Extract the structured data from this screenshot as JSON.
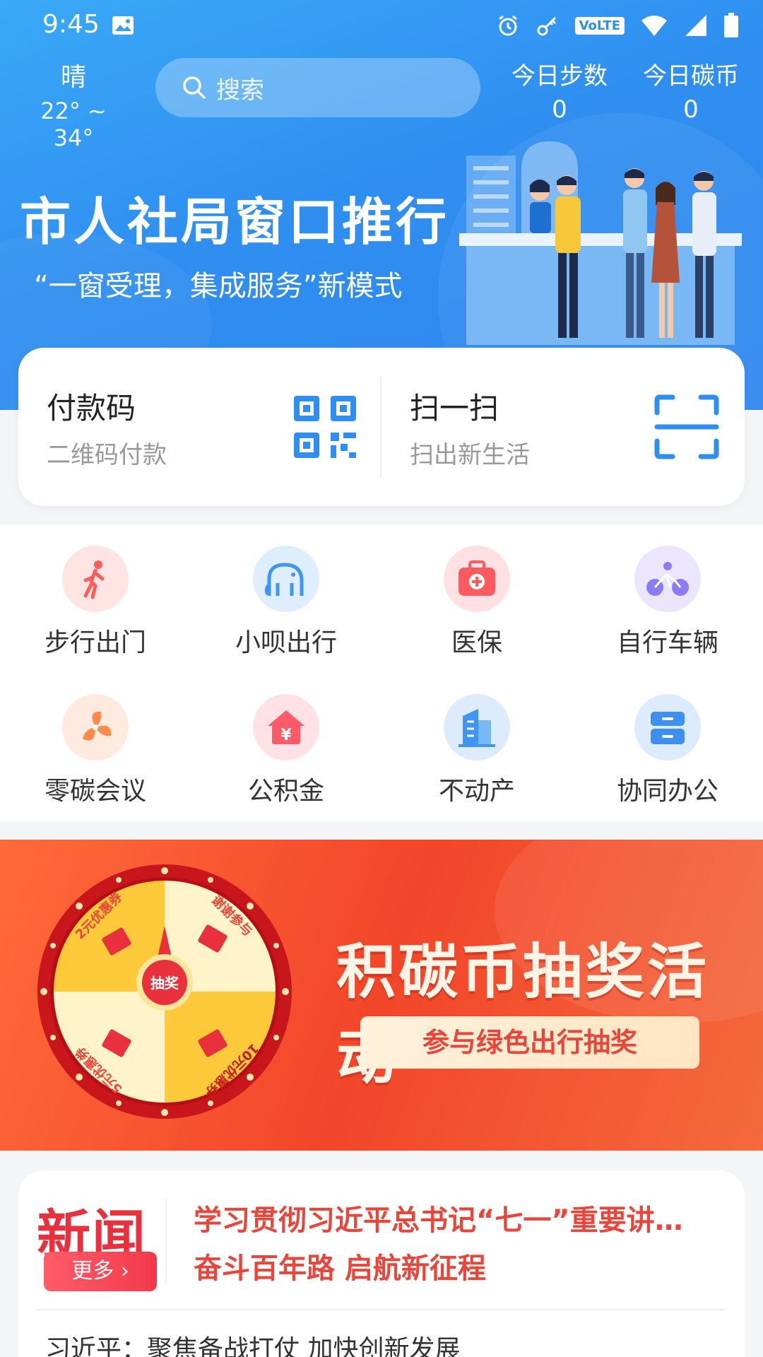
{
  "status_bar": {
    "time": "9:45",
    "network_badge": "VoLTE"
  },
  "header": {
    "weather": {
      "condition": "晴",
      "temp_range": "22° ~ 34°"
    },
    "search": {
      "placeholder": "搜索"
    },
    "stats": [
      {
        "label": "今日步数",
        "value": "0"
      },
      {
        "label": "今日碳币",
        "value": "0"
      }
    ]
  },
  "hero_banner": {
    "title": "市人社局窗口推行",
    "subtitle": "“一窗受理，集成服务”新模式"
  },
  "quick_actions": [
    {
      "title": "付款码",
      "subtitle": "二维码付款",
      "icon": "qr-code-icon"
    },
    {
      "title": "扫一扫",
      "subtitle": "扫出新生活",
      "icon": "scan-icon"
    }
  ],
  "services": [
    {
      "label": "步行出门",
      "icon": "walking-icon",
      "color": "#ff6b6b"
    },
    {
      "label": "小呗出行",
      "icon": "elephant-icon",
      "color": "#4aa3f5"
    },
    {
      "label": "医保",
      "icon": "medical-kit-icon",
      "color": "#ff5a5f"
    },
    {
      "label": "自行车辆",
      "icon": "bicycle-icon",
      "color": "#8b7cf6"
    },
    {
      "label": "零碳会议",
      "icon": "fan-icon",
      "color": "#ff8a4c"
    },
    {
      "label": "公积金",
      "icon": "house-fund-icon",
      "color": "#ff5a6a"
    },
    {
      "label": "不动产",
      "icon": "building-icon",
      "color": "#3f95f2"
    },
    {
      "label": "协同办公",
      "icon": "cabinet-icon",
      "color": "#3f8ff0"
    }
  ],
  "lottery_banner": {
    "title": "积碳币抽奖活动",
    "subtitle": "参与绿色出行抽奖",
    "wheel_center": "抽奖",
    "wheel_prizes": [
      "2元优惠券",
      "谢谢参与",
      "10元优惠券",
      "5元优惠券"
    ]
  },
  "news": {
    "brand": "新闻",
    "more_label": "更多",
    "headlines": [
      "学习贯彻习近平总书记“七一”重要讲…",
      "奋斗百年路 启航新征程",
      "习近平：聚焦备战打仗 加快创新发展"
    ]
  },
  "colors": {
    "primary_blue": "#2f8ff0",
    "accent_red": "#e8463a"
  }
}
